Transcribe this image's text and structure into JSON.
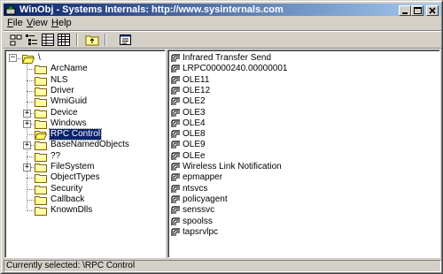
{
  "window": {
    "title": "WinObj - Systems Internals: http://www.sysinternals.com",
    "minimize_label": "_",
    "maximize_label": "□",
    "close_label": "×"
  },
  "menu": [
    {
      "label": "File",
      "accel": "F"
    },
    {
      "label": "View",
      "accel": "V"
    },
    {
      "label": "Help",
      "accel": "H"
    }
  ],
  "toolbar": {
    "icons": [
      "large-icons-icon",
      "list-icon",
      "details-icon",
      "grid-icon",
      "up-folder-icon",
      "properties-icon"
    ]
  },
  "tree": {
    "root": {
      "label": "\\",
      "expander": "−"
    },
    "items": [
      {
        "label": "ArcName",
        "expander": ""
      },
      {
        "label": "NLS",
        "expander": ""
      },
      {
        "label": "Driver",
        "expander": ""
      },
      {
        "label": "WmiGuid",
        "expander": ""
      },
      {
        "label": "Device",
        "expander": "+"
      },
      {
        "label": "Windows",
        "expander": "+"
      },
      {
        "label": "RPC Control",
        "expander": "",
        "selected": true
      },
      {
        "label": "BaseNamedObjects",
        "expander": "+"
      },
      {
        "label": "??",
        "expander": ""
      },
      {
        "label": "FileSystem",
        "expander": "+"
      },
      {
        "label": "ObjectTypes",
        "expander": ""
      },
      {
        "label": "Security",
        "expander": ""
      },
      {
        "label": "Callback",
        "expander": ""
      },
      {
        "label": "KnownDlls",
        "expander": ""
      }
    ]
  },
  "objects": [
    "Infrared Transfer Send",
    "LRPC00000240.00000001",
    "OLE11",
    "OLE12",
    "OLE2",
    "OLE3",
    "OLE4",
    "OLE8",
    "OLE9",
    "OLEe",
    "Wireless Link Notification",
    "epmapper",
    "ntsvcs",
    "policyagent",
    "senssvc",
    "spoolss",
    "tapsrvlpc"
  ],
  "status": {
    "text": "Currently selected:  \\RPC Control"
  },
  "colors": {
    "titlebar_start": "#0a246a",
    "titlebar_end": "#a6caf0",
    "selection": "#0a246a",
    "folder": "#ffff99"
  }
}
